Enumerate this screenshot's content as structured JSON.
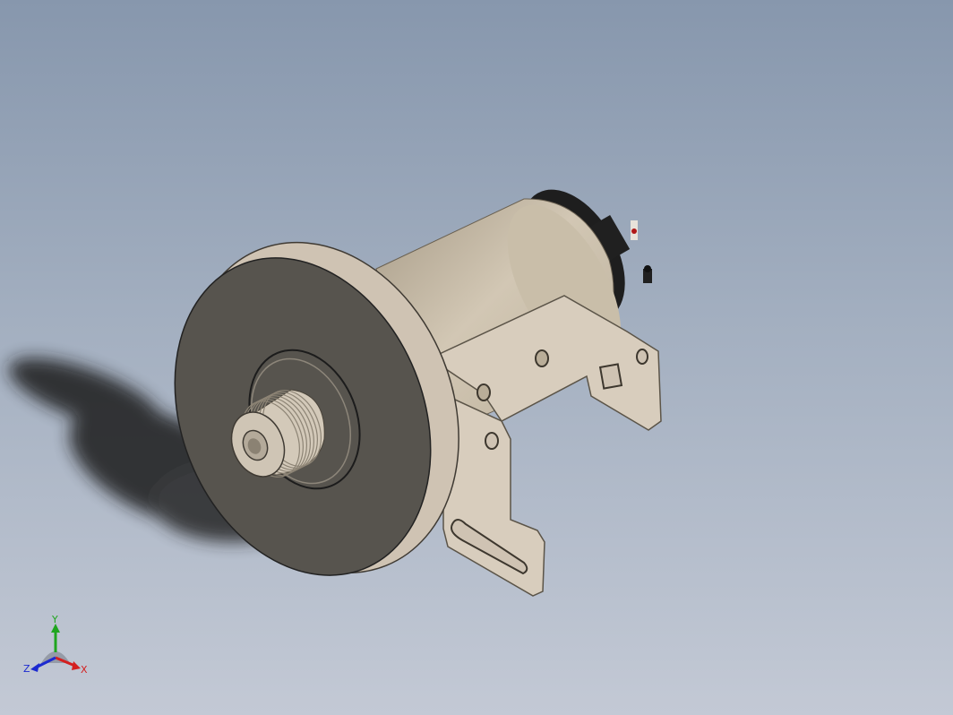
{
  "viewport": {
    "background_top": "#8797ad",
    "background_bottom": "#c3c9d5"
  },
  "model": {
    "description_icon": "motor-assembly",
    "colors": {
      "body": "#c8bda9",
      "body_shadow": "#a89c88",
      "flange_face": "#57544e",
      "flange_rim": "#cfc3b3",
      "bracket": "#d8cdbd",
      "bracket_edge": "#5b5448",
      "end_cap": "#1e1e1e",
      "shaft": "#d3c9b9"
    }
  },
  "triad": {
    "x_label": "X",
    "y_label": "Y",
    "z_label": "Z",
    "x_color": "#d42020",
    "y_color": "#1fa51f",
    "z_color": "#1c2ad0"
  }
}
